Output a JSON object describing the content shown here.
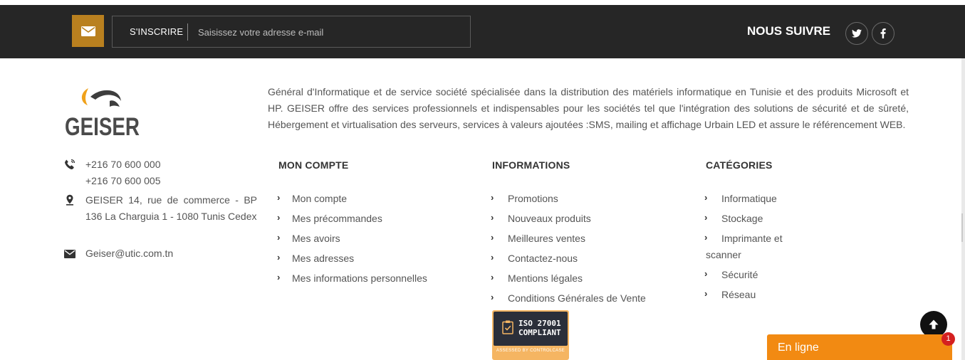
{
  "newsletter": {
    "subscribe_label": "S'INSCRIRE",
    "email_placeholder": "Saisissez votre adresse e-mail",
    "mail_icon": "envelope-icon",
    "accent_color": "#b9801f",
    "bar_color": "#262626"
  },
  "social": {
    "title": "NOUS SUIVRE",
    "items": [
      {
        "name": "twitter",
        "icon": "twitter-icon"
      },
      {
        "name": "facebook",
        "icon": "facebook-icon"
      }
    ]
  },
  "brand": {
    "logo_text": "GEISER",
    "about": "Général d'Informatique et de service société spécialisée dans la distribution des matériels informatique en Tunisie et des produits Microsoft et HP. GEISER offre des services professionnels et indispensables pour les sociétés tel que l'intégration des solutions de sécurité et de sûreté, Hébergement et virtualisation des serveurs, services à valeurs ajoutées :SMS, mailing et affichage Urbain LED et assure le référencement WEB."
  },
  "contact": {
    "phone_1": "+216 70 600 000",
    "phone_2": "+216 70 600 005",
    "address": "GEISER 14, rue de commerce - BP 136 La Charguia 1 - 1080 Tunis Cedex",
    "email": "Geiser@utic.com.tn"
  },
  "columns": {
    "account": {
      "title": "MON COMPTE",
      "links": [
        "Mon compte",
        "Mes précommandes",
        "Mes avoirs",
        "Mes adresses",
        "Mes informations personnelles"
      ]
    },
    "information": {
      "title": "INFORMATIONS",
      "links": [
        "Promotions",
        "Nouveaux produits",
        "Meilleures ventes",
        "Contactez-nous",
        "Mentions légales",
        "Conditions Générales de Vente"
      ]
    },
    "categories": {
      "title": "CATÉGORIES",
      "links": [
        "Informatique",
        "Stockage",
        "Imprimante et",
        "scanner",
        "Sécurité",
        "Réseau"
      ]
    }
  },
  "badge": {
    "line1": "ISO 27001",
    "line2": "COMPLIANT",
    "assessed": "ASSESSED BY CONTROLCASE"
  },
  "chat": {
    "label": "En ligne",
    "count": "1",
    "color": "#f28a12"
  }
}
